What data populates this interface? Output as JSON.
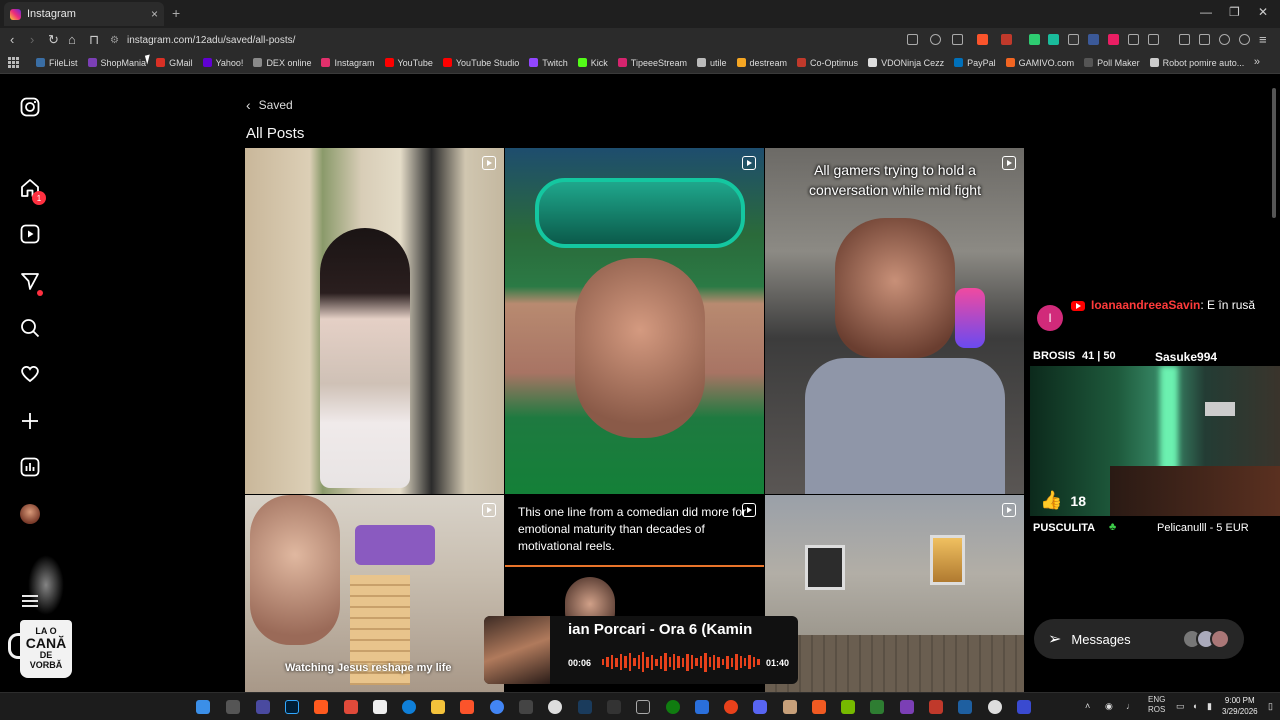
{
  "browser": {
    "tab_title": "Instagram",
    "tab_close": "×",
    "new_tab": "+",
    "url": "instagram.com/12adu/saved/all-posts/",
    "bookmarks": [
      {
        "label": "FileList",
        "color": "#3a6ea5"
      },
      {
        "label": "ShopMania",
        "color": "#7b3fb5"
      },
      {
        "label": "GMail",
        "color": "#d93025"
      },
      {
        "label": "Yahoo!",
        "color": "#6001d2"
      },
      {
        "label": "DEX online",
        "color": "#8a8a8a"
      },
      {
        "label": "Instagram",
        "color": "#e1306c"
      },
      {
        "label": "YouTube",
        "color": "#ff0000"
      },
      {
        "label": "YouTube Studio",
        "color": "#ff0000"
      },
      {
        "label": "Twitch",
        "color": "#9146ff"
      },
      {
        "label": "Kick",
        "color": "#53fc18"
      },
      {
        "label": "TipeeeStream",
        "color": "#d6246e"
      },
      {
        "label": "utile",
        "color": "#bbbbbb"
      },
      {
        "label": "destream",
        "color": "#f5a623"
      },
      {
        "label": "Co-Optimus",
        "color": "#c0392b"
      },
      {
        "label": "VDONinja Cezz",
        "color": "#dddddd"
      },
      {
        "label": "PayPal",
        "color": "#0070ba"
      },
      {
        "label": "GAMIVO.com",
        "color": "#f26522"
      },
      {
        "label": "Poll Maker",
        "color": "#555555"
      },
      {
        "label": "Robot pomire auto...",
        "color": "#cccccc"
      }
    ],
    "bookmarks_more": "»"
  },
  "sidebar": {
    "notifications_count": "1"
  },
  "main": {
    "back_label": "Saved",
    "title": "All Posts"
  },
  "posts": [
    {
      "caption": ""
    },
    {
      "caption": ""
    },
    {
      "caption": "All gamers trying to hold a conversation while mid fight"
    },
    {
      "caption": ""
    },
    {
      "caption": "This one line from a comedian did more for emotional maturity than decades of motivational reels."
    },
    {
      "caption": ""
    }
  ],
  "post_overlay": {
    "jenga_caption": "Watching Jesus reshape my life"
  },
  "chat_widget": {
    "avatar_letter": "I",
    "username": "IoanaandreeaSavin",
    "message": ": E în rusă"
  },
  "stream_stats": {
    "brand": "BROSIS",
    "score": "41 | 50",
    "player": "Sasuke994",
    "likes": "18",
    "donation_label": "PUSCULITA",
    "donation_text": "Pelicanulll - 5 EUR"
  },
  "messages": {
    "label": "Messages"
  },
  "mug": {
    "line1": "LA O",
    "line2": "CANĂ",
    "line3": "DE",
    "line4": "VORBĂ"
  },
  "player": {
    "title": "ian Porcari - Ora 6 (Kamin",
    "time_current": "00:06",
    "time_total": "01:40"
  },
  "taskbar": {
    "lang1": "ENG",
    "lang2": "ROS",
    "time": "9:00 PM",
    "date": "3/29/2026"
  }
}
